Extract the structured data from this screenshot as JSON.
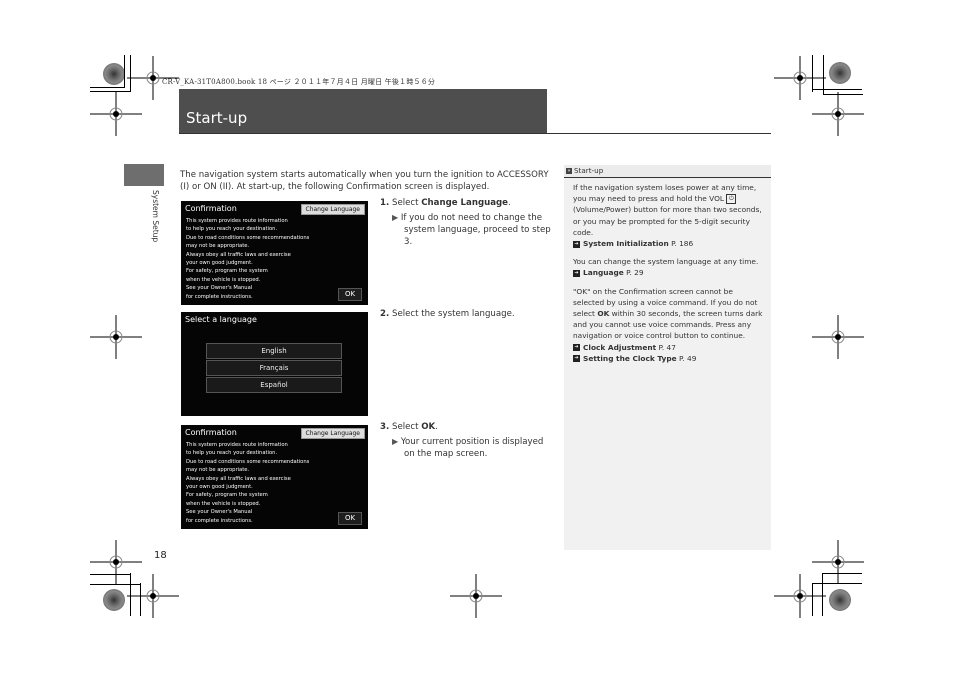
{
  "print_header": "CR-V_KA-31T0A800.book  18 ページ  ２０１１年７月４日  月曜日  午後１時５６分",
  "title": "Start-up",
  "side_tab_label": "System Setup",
  "intro": "The navigation system starts automatically when you turn the ignition to ACCESSORY (I) or ON (II). At start-up, the following Confirmation screen is displayed.",
  "screens": {
    "confirmation": {
      "title": "Confirmation",
      "change_language_button": "Change Language",
      "body_lines": [
        "This system provides route information",
        "to help you reach your destination.",
        "Due to road conditions some recommendations",
        "may not be appropriate.",
        "Always obey all traffic laws and exercise",
        "your own good judgment.",
        "For safety, program the system",
        "when the vehicle is stopped.",
        "See your Owner's Manual",
        "for complete instructions."
      ],
      "ok_button": "OK"
    },
    "select_language": {
      "title": "Select a language",
      "options": [
        "English",
        "Français",
        "Español"
      ]
    }
  },
  "steps": [
    {
      "num": "1.",
      "prefix": "Select ",
      "bold": "Change Language",
      "suffix": ".",
      "note": "If you do not need to change the system language, proceed to step 3."
    },
    {
      "num": "2.",
      "prefix": "Select the system language.",
      "bold": "",
      "suffix": "",
      "note": ""
    },
    {
      "num": "3.",
      "prefix": "Select ",
      "bold": "OK",
      "suffix": ".",
      "note": "Your current position is displayed on the map screen."
    }
  ],
  "sidebar": {
    "heading": "Start-up",
    "para1_a": "If the navigation system loses power at any time, you may need to press and hold the VOL ",
    "para1_b": " (Volume/Power) button for more than two seconds, or you may be prompted for the 5-digit security code.",
    "xref1": {
      "label": "System Initialization",
      "page": "P. 186"
    },
    "para2": "You can change the system language at any time.",
    "xref2": {
      "label": "Language",
      "page": "P. 29"
    },
    "para3_a": "\"OK\" on the Confirmation screen cannot be selected by using a voice command. If you do not select ",
    "para3_bold": "OK",
    "para3_b": " within 30 seconds, the screen turns dark and you cannot use voice commands. Press any navigation or voice control button to continue.",
    "xref3": {
      "label": "Clock Adjustment",
      "page": "P. 47"
    },
    "xref4": {
      "label": "Setting the Clock Type",
      "page": "P. 49"
    }
  },
  "page_number": "18"
}
